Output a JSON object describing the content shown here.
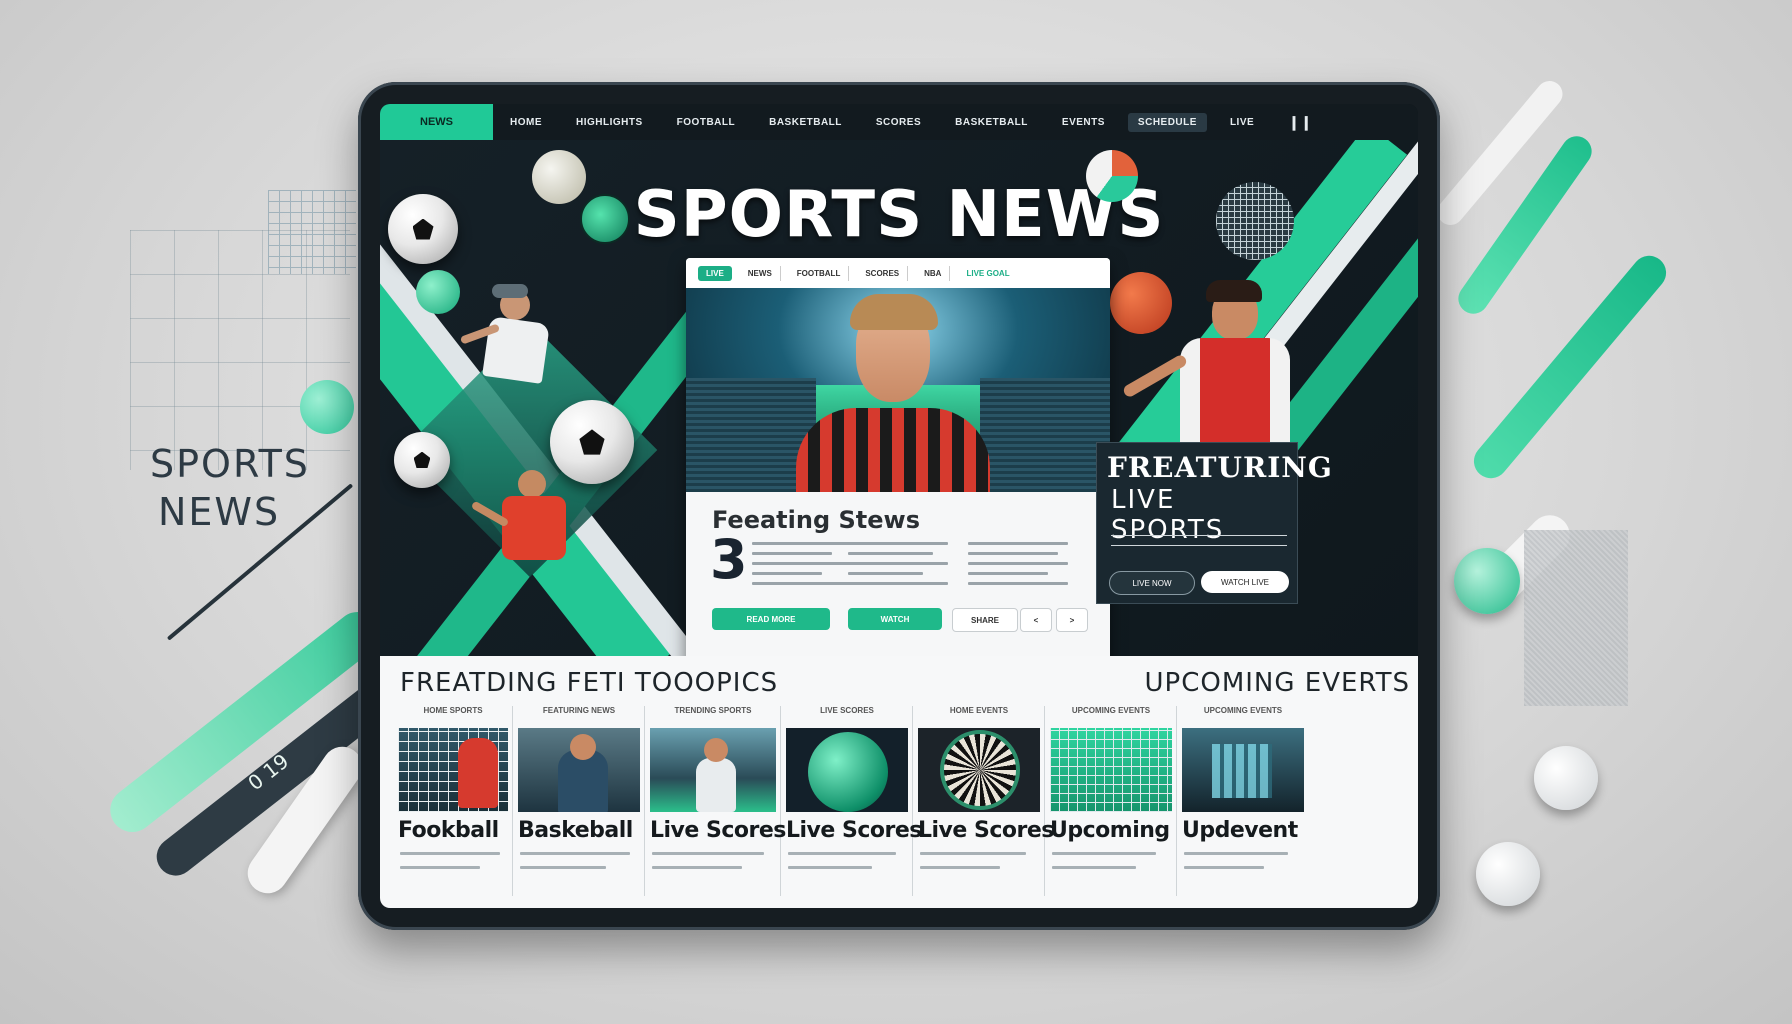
{
  "colors": {
    "accent": "#20c997",
    "dark": "#121a1f",
    "panel": "#f7f8f9",
    "red": "#d83b2f"
  },
  "side": {
    "title_line1": "SPORTS",
    "title_line2": "NEWS",
    "counter": "0 19"
  },
  "nav": {
    "active": "NEWS",
    "items": [
      "HOME",
      "HIGHLIGHTS",
      "FOOTBALL",
      "BASKETBALL",
      "SCORES",
      "BASKETBALL"
    ],
    "extra": [
      "EVENTS",
      "SCHEDULE",
      "LIVE"
    ]
  },
  "hero": {
    "title": "SPORTS NEWS"
  },
  "article": {
    "tabs": [
      "LIVE",
      "NEWS",
      "FOOTBALL",
      "SCORES",
      "NBA",
      "LIVE GOAL"
    ],
    "headline": "Feeating Stews",
    "number": "3",
    "buttons": [
      "READ MORE",
      "WATCH",
      "SHARE",
      "<",
      "> "
    ]
  },
  "featuring": {
    "title": "FREATURING",
    "subtitle": "LIVE SPORTS",
    "buttons": [
      "LIVE NOW",
      "WATCH LIVE"
    ]
  },
  "bottom": {
    "left_heading": "FREATDING FETI TOOOPICS",
    "right_heading": "UPCOMING EVERTS",
    "cards": [
      {
        "tag": "HOME SPORTS",
        "label": "Fookball"
      },
      {
        "tag": "FEATURING NEWS",
        "label": "Baskeball"
      },
      {
        "tag": "TRENDING SPORTS",
        "label": "Live Scores"
      },
      {
        "tag": "LIVE SCORES",
        "label": "Live Scores"
      },
      {
        "tag": "HOME EVENTS",
        "label": "Live Scores"
      },
      {
        "tag": "UPCOMING EVENTS",
        "label": "Upcoming"
      },
      {
        "tag": "UPCOMING EVENTS",
        "label": "Updevent"
      }
    ]
  }
}
